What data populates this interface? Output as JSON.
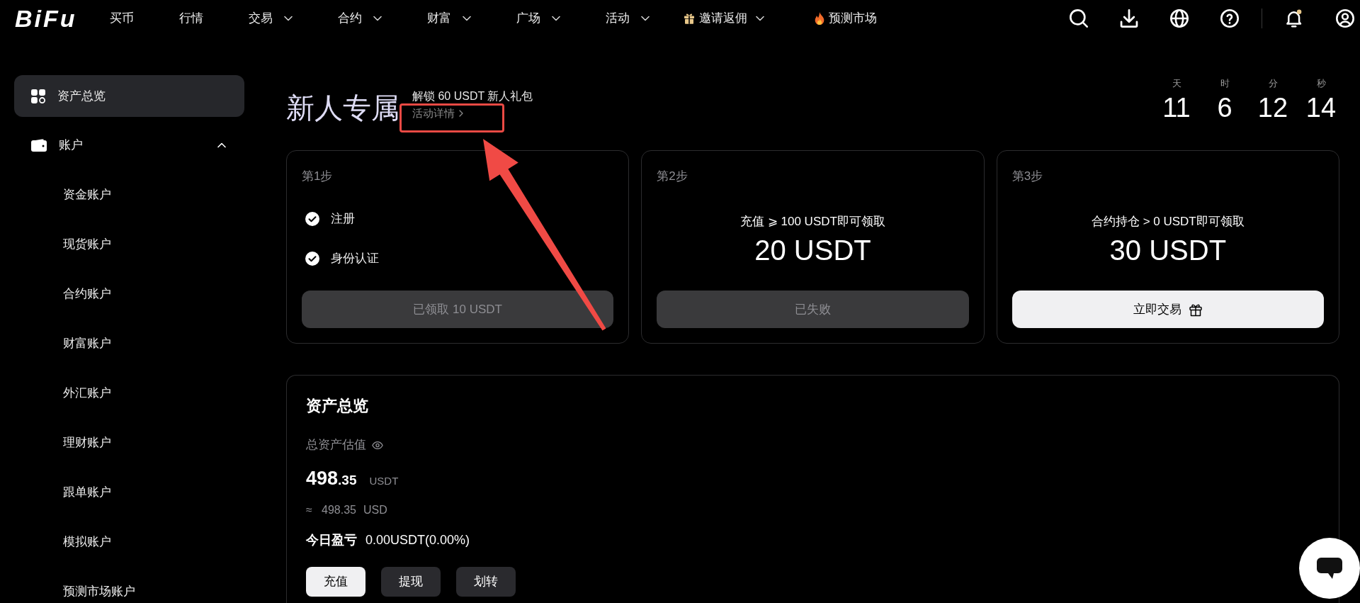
{
  "top_nav": {
    "logo": "BiFu",
    "items": [
      {
        "label": "买币",
        "dropdown": false
      },
      {
        "label": "行情",
        "dropdown": false
      },
      {
        "label": "交易",
        "dropdown": true
      },
      {
        "label": "合约",
        "dropdown": true
      },
      {
        "label": "财富",
        "dropdown": true
      },
      {
        "label": "广场",
        "dropdown": true
      },
      {
        "label": "活动",
        "dropdown": true
      }
    ],
    "promos": [
      {
        "kind": "gift",
        "label": "邀请返佣",
        "dropdown": true
      },
      {
        "kind": "fire",
        "label": "预测市场",
        "dropdown": false
      }
    ],
    "notifications": {
      "unread": true
    }
  },
  "sidebar": {
    "items": [
      {
        "kind": "overview",
        "label": "资产总览",
        "selected": true
      },
      {
        "kind": "wallet",
        "label": "账户",
        "selected": false,
        "expanded": true,
        "children": [
          {
            "label": "资金账户",
            "selected": false
          },
          {
            "label": "现货账户",
            "selected": false
          },
          {
            "label": "合约账户",
            "selected": false
          },
          {
            "label": "财富账户",
            "selected": false
          },
          {
            "label": "外汇账户",
            "selected": false
          },
          {
            "label": "理财账户",
            "selected": false
          },
          {
            "label": "跟单账户",
            "selected": false
          },
          {
            "label": "模拟账户",
            "selected": false
          },
          {
            "label": "预测市场账户",
            "selected": false
          }
        ]
      }
    ]
  },
  "promo": {
    "title": "新人专属",
    "subtitle": "解锁 60 USDT 新人礼包",
    "link": "活动详情"
  },
  "countdown": [
    {
      "label": "天",
      "value": "11"
    },
    {
      "label": "时",
      "value": "6"
    },
    {
      "label": "分",
      "value": "12"
    },
    {
      "label": "秒",
      "value": "14"
    }
  ],
  "steps": [
    {
      "kind": "checklist",
      "step": "第1步",
      "tasks": [
        {
          "label": "注册",
          "done": true
        },
        {
          "label": "身份认证",
          "done": true
        }
      ],
      "button": {
        "label": "已领取 10 USDT",
        "disabled": true
      }
    },
    {
      "kind": "reward",
      "step": "第2步",
      "condition": "充值 ⩾ 100 USDT即可领取",
      "reward": "20 USDT",
      "button": {
        "label": "已失败",
        "disabled": true
      }
    },
    {
      "kind": "reward",
      "step": "第3步",
      "condition": "合约持仓 > 0 USDT即可领取",
      "reward": "30 USDT",
      "button": {
        "label": "立即交易",
        "disabled": false
      }
    }
  ],
  "assets": {
    "title": "资产总览",
    "label": "总资产估值",
    "balance_visible": true,
    "amount": {
      "integer": "498",
      "decimal": ".35",
      "unit": "USDT"
    },
    "approx": {
      "symbol": "≈",
      "value": "498.35",
      "unit": "USD"
    },
    "pnl": {
      "label": "今日盈亏",
      "value": "0.00USDT(0.00%)"
    },
    "actions": [
      {
        "label": "充值",
        "kind": "primary"
      },
      {
        "label": "提现",
        "kind": "secondary"
      },
      {
        "label": "划转",
        "kind": "secondary"
      }
    ]
  }
}
